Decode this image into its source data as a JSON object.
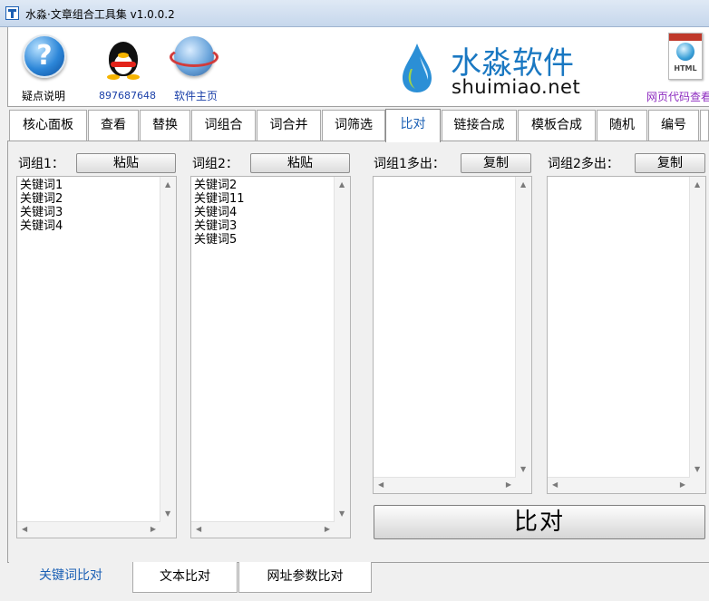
{
  "window": {
    "title": "水淼·文章组合工具集 v1.0.0.2"
  },
  "toolbar": {
    "help_label": "疑点说明",
    "qq_label": "897687648",
    "home_label": "软件主页",
    "brand_title": "水淼软件",
    "brand_site": "shuimiao.net",
    "html_label": "网页代码查看",
    "html_icon_text": "HTML"
  },
  "tabs": [
    "核心面板",
    "查看",
    "替换",
    "词组合",
    "词合并",
    "词筛选",
    "比对",
    "链接合成",
    "模板合成",
    "随机",
    "编号"
  ],
  "active_tab": "比对",
  "panel": {
    "group1": {
      "label": "词组1：",
      "button": "粘贴",
      "items": [
        "关键词1",
        "关键词2",
        "关键词3",
        "关键词4"
      ]
    },
    "group2": {
      "label": "词组2：",
      "button": "粘贴",
      "items": [
        "关键词2",
        "关键词11",
        "关键词4",
        "关键词3",
        "关键词5"
      ]
    },
    "extra1": {
      "label": "词组1多出：",
      "button": "复制"
    },
    "extra2": {
      "label": "词组2多出：",
      "button": "复制"
    },
    "compare_button": "比对"
  },
  "bottom_tabs": [
    "关键词比对",
    "文本比对",
    "网址参数比对"
  ],
  "colors": {
    "accent": "#1a5fb4",
    "brand": "#1a78c2",
    "html_label": "#8e2cc0",
    "qq_label": "#1a3fa8"
  }
}
